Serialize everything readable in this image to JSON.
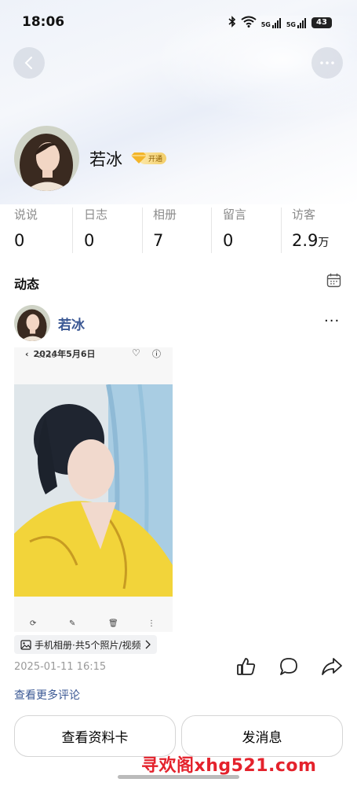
{
  "status": {
    "time": "18:06",
    "signal1": "5G",
    "signal2": "5G",
    "battery": "43"
  },
  "profile": {
    "name": "若冰",
    "vip_label": "开通"
  },
  "stats": [
    {
      "label": "说说",
      "value": "0",
      "unit": ""
    },
    {
      "label": "日志",
      "value": "0",
      "unit": ""
    },
    {
      "label": "相册",
      "value": "7",
      "unit": ""
    },
    {
      "label": "留言",
      "value": "0",
      "unit": ""
    },
    {
      "label": "访客",
      "value": "2.9",
      "unit": "万"
    }
  ],
  "feed": {
    "section_title": "动态",
    "post": {
      "author": "若冰",
      "screenshot_title": "2024年5月6日",
      "screenshot_time": "21:16",
      "album_label": "手机相册·共5个照片/视频",
      "date": "2025-01-11 16:15",
      "see_more": "查看更多评论"
    }
  },
  "actions": {
    "profile_card": "查看资料卡",
    "message": "发消息"
  },
  "watermark": "寻欢阁xhg521.com",
  "colors": {
    "link": "#3b5894",
    "watermark": "#e4222c",
    "vip": "#f4cf6b"
  }
}
